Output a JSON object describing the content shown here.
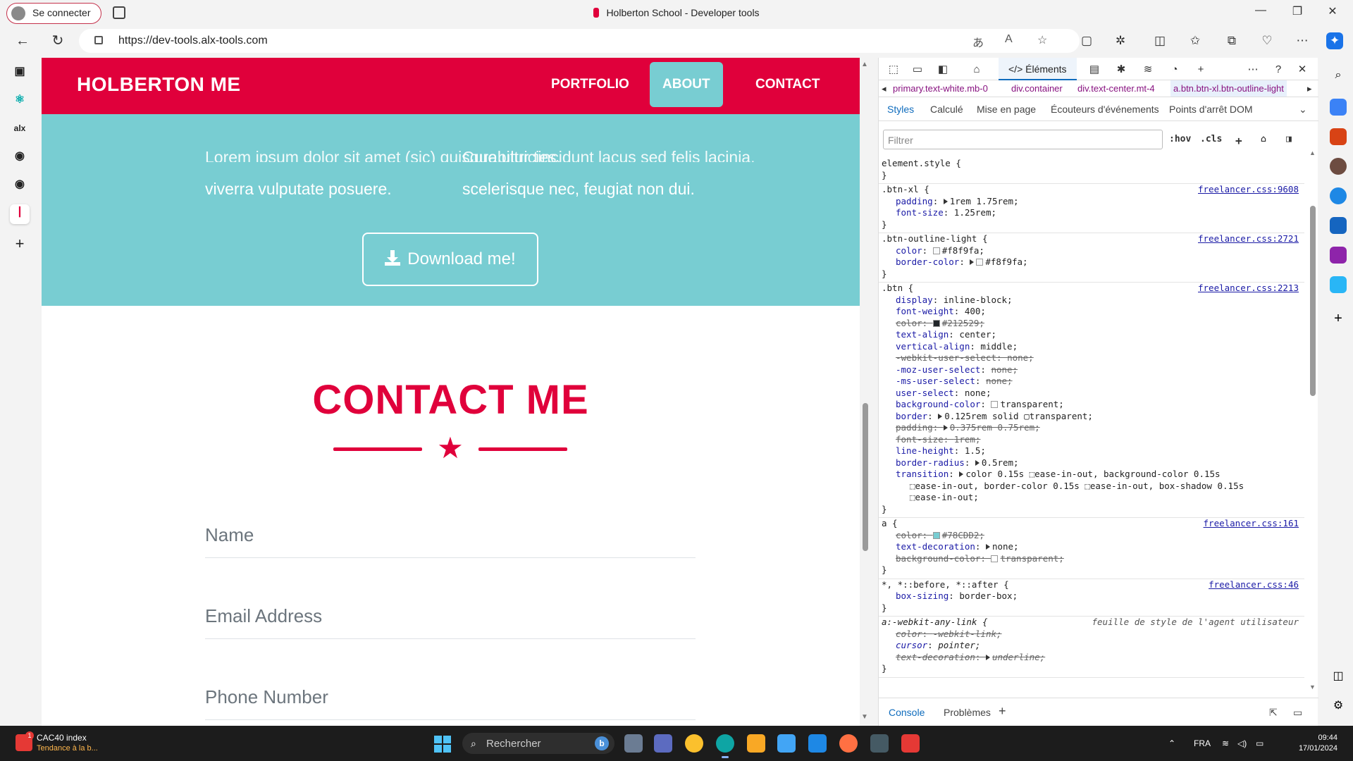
{
  "browser": {
    "signin_label": "Se connecter",
    "tab_title": "Holberton School - Developer tools",
    "url": "https://dev-tools.alx-tools.com",
    "win_minimize": "—",
    "win_restore": "❐",
    "win_close": "✕"
  },
  "sidebar": {
    "items": [
      {
        "icon": "tab-actions-icon",
        "glyph": "▣"
      },
      {
        "icon": "react-icon",
        "glyph": "⚛"
      },
      {
        "icon": "alx-icon",
        "glyph": "alx"
      },
      {
        "icon": "github-icon",
        "glyph": "◉"
      },
      {
        "icon": "github-icon",
        "glyph": "◉"
      },
      {
        "icon": "holberton-icon",
        "glyph": "ꟾ"
      },
      {
        "icon": "add-icon",
        "glyph": "+"
      }
    ]
  },
  "site": {
    "brand": "HOLBERTON ME",
    "nav": [
      "PORTFOLIO",
      "ABOUT",
      "CONTACT"
    ],
    "hero_left_clip": "Lorem ipsum dolor sit amet (sic) quisque ultricies,",
    "hero_right_clip": "Curabitur tincidunt lacus sed felis lacinia,",
    "hero_left": "viverra vulputate posuere.",
    "hero_right": "scelerisque nec, feugiat non dui.",
    "download_label": "Download me!",
    "contact_title": "CONTACT ME",
    "fields": [
      "Name",
      "Email Address",
      "Phone Number"
    ]
  },
  "colors": {
    "primary": "#e0003b",
    "accent": "#78cdd2"
  },
  "devtools": {
    "active_tab": "Éléments",
    "breadcrumbs": [
      "primary.text-white.mb-0",
      "div.container",
      "div.text-center.mt-4",
      "a.btn.btn-xl.btn-outline-light"
    ],
    "subtabs": [
      "Styles",
      "Calculé",
      "Mise en page",
      "Écouteurs d'événements",
      "Points d'arrêt DOM"
    ],
    "filter_placeholder": "Filtrer",
    "hov": ":hov",
    "cls": ".cls",
    "rules": [
      {
        "selector": "element.style {",
        "source": "",
        "decls": []
      },
      {
        "selector": ".btn-xl {",
        "source": "freelancer.css:9608",
        "decls": [
          {
            "prop": "padding",
            "val": "1rem 1.75rem;",
            "tri": true
          },
          {
            "prop": "font-size",
            "val": "1.25rem;"
          }
        ]
      },
      {
        "selector": ".btn-outline-light {",
        "source": "freelancer.css:2721",
        "decls": [
          {
            "prop": "color",
            "val": "#f8f9fa;",
            "swatch": "#f8f9fa"
          },
          {
            "prop": "border-color",
            "val": "#f8f9fa;",
            "tri": true,
            "swatch": "#f8f9fa"
          }
        ]
      },
      {
        "selector": ".btn {",
        "source": "freelancer.css:2213",
        "decls": [
          {
            "prop": "display",
            "val": "inline-block;"
          },
          {
            "prop": "font-weight",
            "val": "400;"
          },
          {
            "prop": "color",
            "val": "#212529;",
            "strike": true,
            "swatch": "#212529"
          },
          {
            "prop": "text-align",
            "val": "center;"
          },
          {
            "prop": "vertical-align",
            "val": "middle;"
          },
          {
            "prop": "-webkit-user-select",
            "val": "none;",
            "strike": true
          },
          {
            "prop": "-moz-user-select",
            "val": "none;",
            "valstrike": true
          },
          {
            "prop": "-ms-user-select",
            "val": "none;",
            "valstrike": true
          },
          {
            "prop": "user-select",
            "val": "none;"
          },
          {
            "prop": "background-color",
            "val": "transparent;",
            "swatch": "#ffffff"
          },
          {
            "prop": "border",
            "val": "0.125rem solid ▢transparent;",
            "tri": true
          },
          {
            "prop": "padding",
            "val": "0.375rem 0.75rem;",
            "strike": true,
            "tri": true
          },
          {
            "prop": "font-size",
            "val": "1rem;",
            "strike": true
          },
          {
            "prop": "line-height",
            "val": "1.5;"
          },
          {
            "prop": "border-radius",
            "val": "0.5rem;",
            "tri": true
          },
          {
            "prop": "transition",
            "val": "color 0.15s ⬚ease-in-out, background-color 0.15s",
            "tri": true
          },
          {
            "cont": "⬚ease-in-out, border-color 0.15s ⬚ease-in-out, box-shadow 0.15s"
          },
          {
            "cont": "⬚ease-in-out;"
          }
        ]
      },
      {
        "selector": "a {",
        "source": "freelancer.css:161",
        "decls": [
          {
            "prop": "color",
            "val": "#78CDD2;",
            "strike": true,
            "swatch": "#78cdd2"
          },
          {
            "prop": "text-decoration",
            "val": "none;",
            "tri": true
          },
          {
            "prop": "background-color",
            "val": "transparent;",
            "strike": true,
            "swatch": "#ffffff"
          }
        ]
      },
      {
        "selector": "*, *::before, *::after {",
        "source": "freelancer.css:46",
        "decls": [
          {
            "prop": "box-sizing",
            "val": "border-box;"
          }
        ]
      },
      {
        "selector": "a:-webkit-any-link {",
        "source": "feuille de style de l'agent utilisateur",
        "ua": true,
        "decls": [
          {
            "prop": "color",
            "val": "-webkit-link;",
            "strike": true,
            "ital": true
          },
          {
            "prop": "cursor",
            "val": "pointer;",
            "ital": true
          },
          {
            "prop": "text-decoration",
            "val": "underline;",
            "strike": true,
            "ital": true,
            "tri": true
          }
        ]
      }
    ],
    "drawer_tabs": [
      "Console",
      "Problèmes"
    ]
  },
  "taskbar": {
    "widget_title": "CAC40 index",
    "widget_sub": "Tendance à la b...",
    "widget_badge": "1",
    "search_placeholder": "Rechercher",
    "lang": "FRA",
    "time": "09:44",
    "date": "17/01/2024"
  }
}
